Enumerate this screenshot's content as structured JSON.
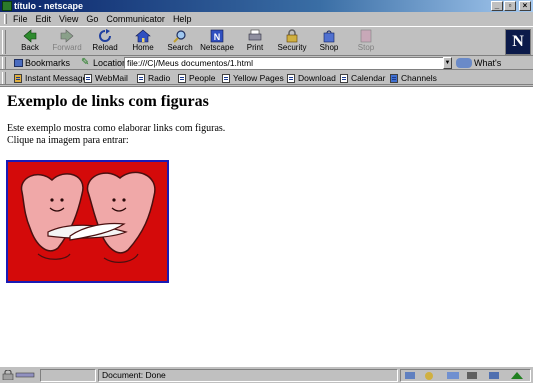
{
  "window": {
    "title": "título - netscape",
    "buttons": [
      "_",
      "▫",
      "×"
    ]
  },
  "menu": [
    {
      "label": "File"
    },
    {
      "label": "Edit"
    },
    {
      "label": "View"
    },
    {
      "label": "Go"
    },
    {
      "label": "Communicator"
    },
    {
      "label": "Help"
    }
  ],
  "nav": {
    "back": "Back",
    "forward": "Forward",
    "reload": "Reload",
    "home": "Home",
    "search": "Search",
    "netscape": "Netscape",
    "print": "Print",
    "security": "Security",
    "shop": "Shop",
    "stop": "Stop",
    "logo": "N"
  },
  "location": {
    "bookmarks": "Bookmarks",
    "label": "Location:",
    "url": "file:///C|/Meus documentos/1.html",
    "related": "What's Related"
  },
  "personal": {
    "instant_message": "Instant Message",
    "webmail": "WebMail",
    "radio": "Radio",
    "people": "People",
    "yellow_pages": "Yellow Pages",
    "download": "Download",
    "calendar": "Calendar",
    "channels": "Channels"
  },
  "page": {
    "heading": "Exemplo de links com figuras",
    "line1": "Este exemplo mostra como elaborar links com figuras.",
    "line2": "Clique na imagem para entrar:"
  },
  "status": {
    "text": "Document: Done"
  },
  "colors": {
    "image_bg": "#d40a0a",
    "link_border": "#1a1ab4",
    "heart": "#f0a8a8"
  }
}
